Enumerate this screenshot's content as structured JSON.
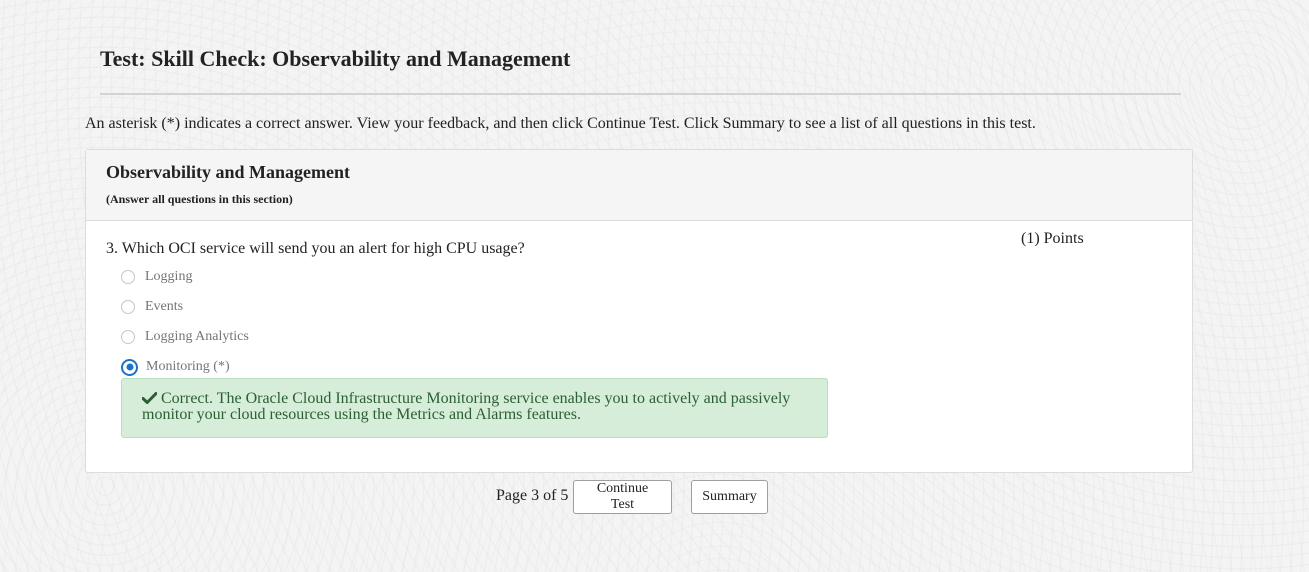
{
  "header": {
    "title": "Test: Skill Check: Observability and Management"
  },
  "instructions": "An asterisk (*) indicates a correct answer. View your feedback, and then click Continue Test. Click Summary to see a list of all questions in this test.",
  "section": {
    "title": "Observability and Management",
    "note": "(Answer all questions in this section)"
  },
  "question": {
    "text": "3. Which OCI service will send you an alert for high CPU usage?",
    "points": "(1) Points",
    "options": [
      {
        "label": "Logging",
        "selected": false
      },
      {
        "label": "Events",
        "selected": false
      },
      {
        "label": "Logging Analytics",
        "selected": false
      },
      {
        "label": "Monitoring (*)",
        "selected": true
      }
    ],
    "feedback": "Correct. The Oracle Cloud Infrastructure Monitoring service enables you to actively and passively monitor your cloud resources using the Metrics and Alarms features.",
    "feedback_icon": "check-icon"
  },
  "footer": {
    "page_indicator": "Page 3 of 5",
    "continue_label": "Continue Test",
    "summary_label": "Summary"
  },
  "colors": {
    "accent": "#1a73c9",
    "feedback_bg": "#d6edd9",
    "feedback_text": "#2b5f33"
  }
}
